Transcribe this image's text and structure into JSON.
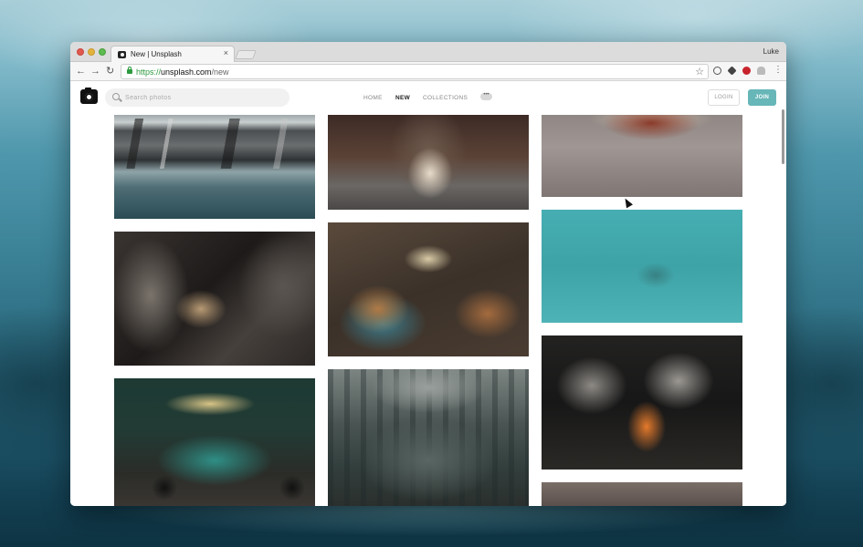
{
  "browser": {
    "tab_title": "New | Unsplash",
    "tab_close": "×",
    "profile_name": "Luke",
    "url_scheme": "https://",
    "url_host": "unsplash.com",
    "url_path": "/new",
    "nav_back": "←",
    "nav_forward": "→",
    "nav_reload": "↻",
    "star": "☆",
    "menu": "⋮"
  },
  "header": {
    "search_placeholder": "Search photos",
    "nav": {
      "home": "HOME",
      "new": "NEW",
      "collections": "COLLECTIONS"
    },
    "more": "•••",
    "login": "LOGIN",
    "join": "JOIN"
  },
  "colors": {
    "accent": "#67b6b8",
    "secure": "#2d9a3e"
  },
  "icons": {
    "logo": "camera-icon",
    "search": "search-icon",
    "lock": "lock-icon",
    "bookmark": "star-icon"
  }
}
